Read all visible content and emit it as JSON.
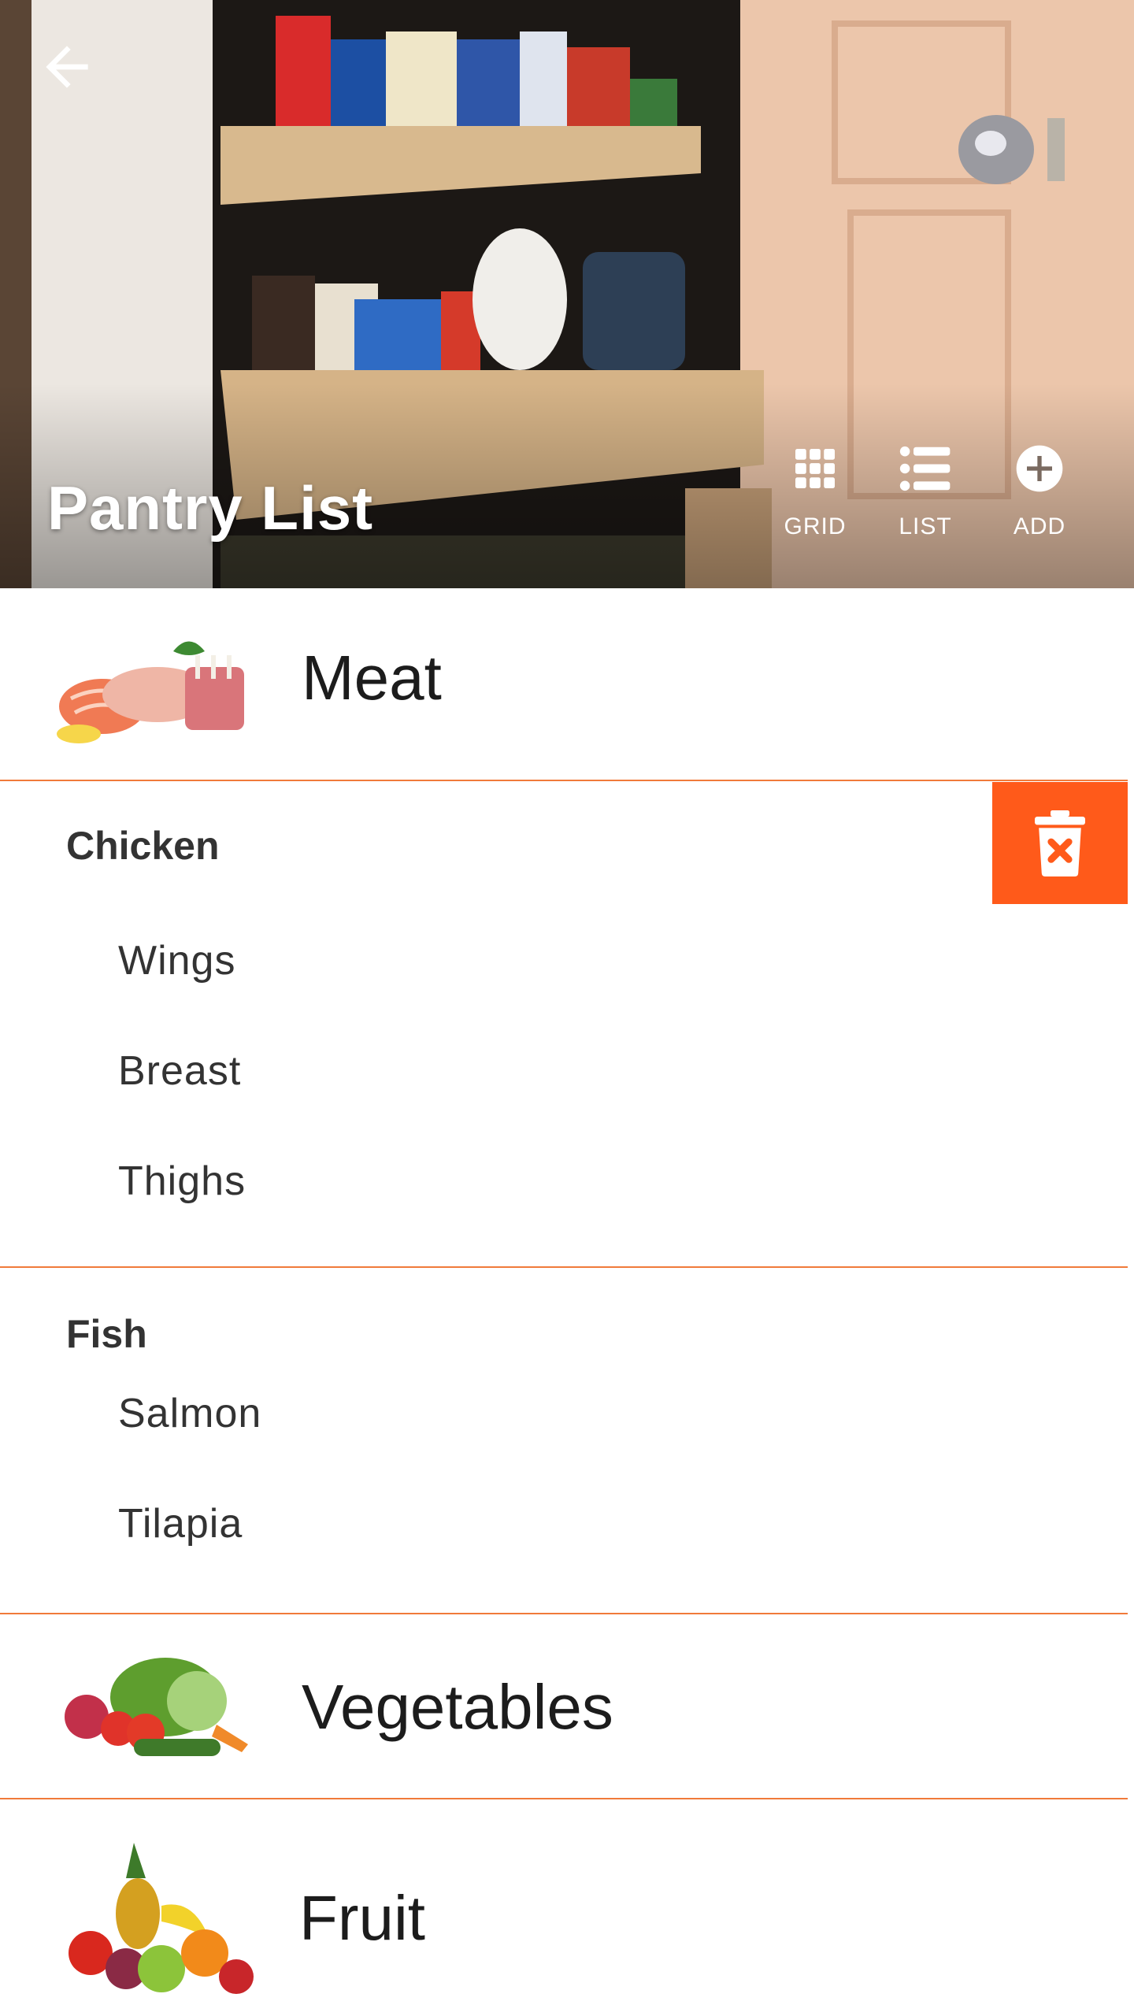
{
  "header": {
    "title": "Pantry List",
    "actions": [
      {
        "label": "GRID",
        "icon": "grid-icon"
      },
      {
        "label": "LIST",
        "icon": "list-icon"
      },
      {
        "label": "ADD",
        "icon": "add-circle-icon"
      }
    ],
    "back_icon": "arrow-back-icon"
  },
  "categories": [
    {
      "name": "Meat",
      "thumb": "meat-thumbnail",
      "groups": [
        {
          "title": "Chicken",
          "items": [
            "Wings",
            "Breast",
            "Thighs"
          ]
        },
        {
          "title": "Fish",
          "items": [
            "Salmon",
            "Tilapia"
          ]
        }
      ]
    },
    {
      "name": "Vegetables",
      "thumb": "vegetables-thumbnail"
    },
    {
      "name": "Fruit",
      "thumb": "fruit-thumbnail"
    }
  ],
  "delete_action": {
    "icon": "delete-x-icon"
  },
  "colors": {
    "accent": "#ff5a1a",
    "divider": "#f07a3a",
    "text": "#333333"
  }
}
